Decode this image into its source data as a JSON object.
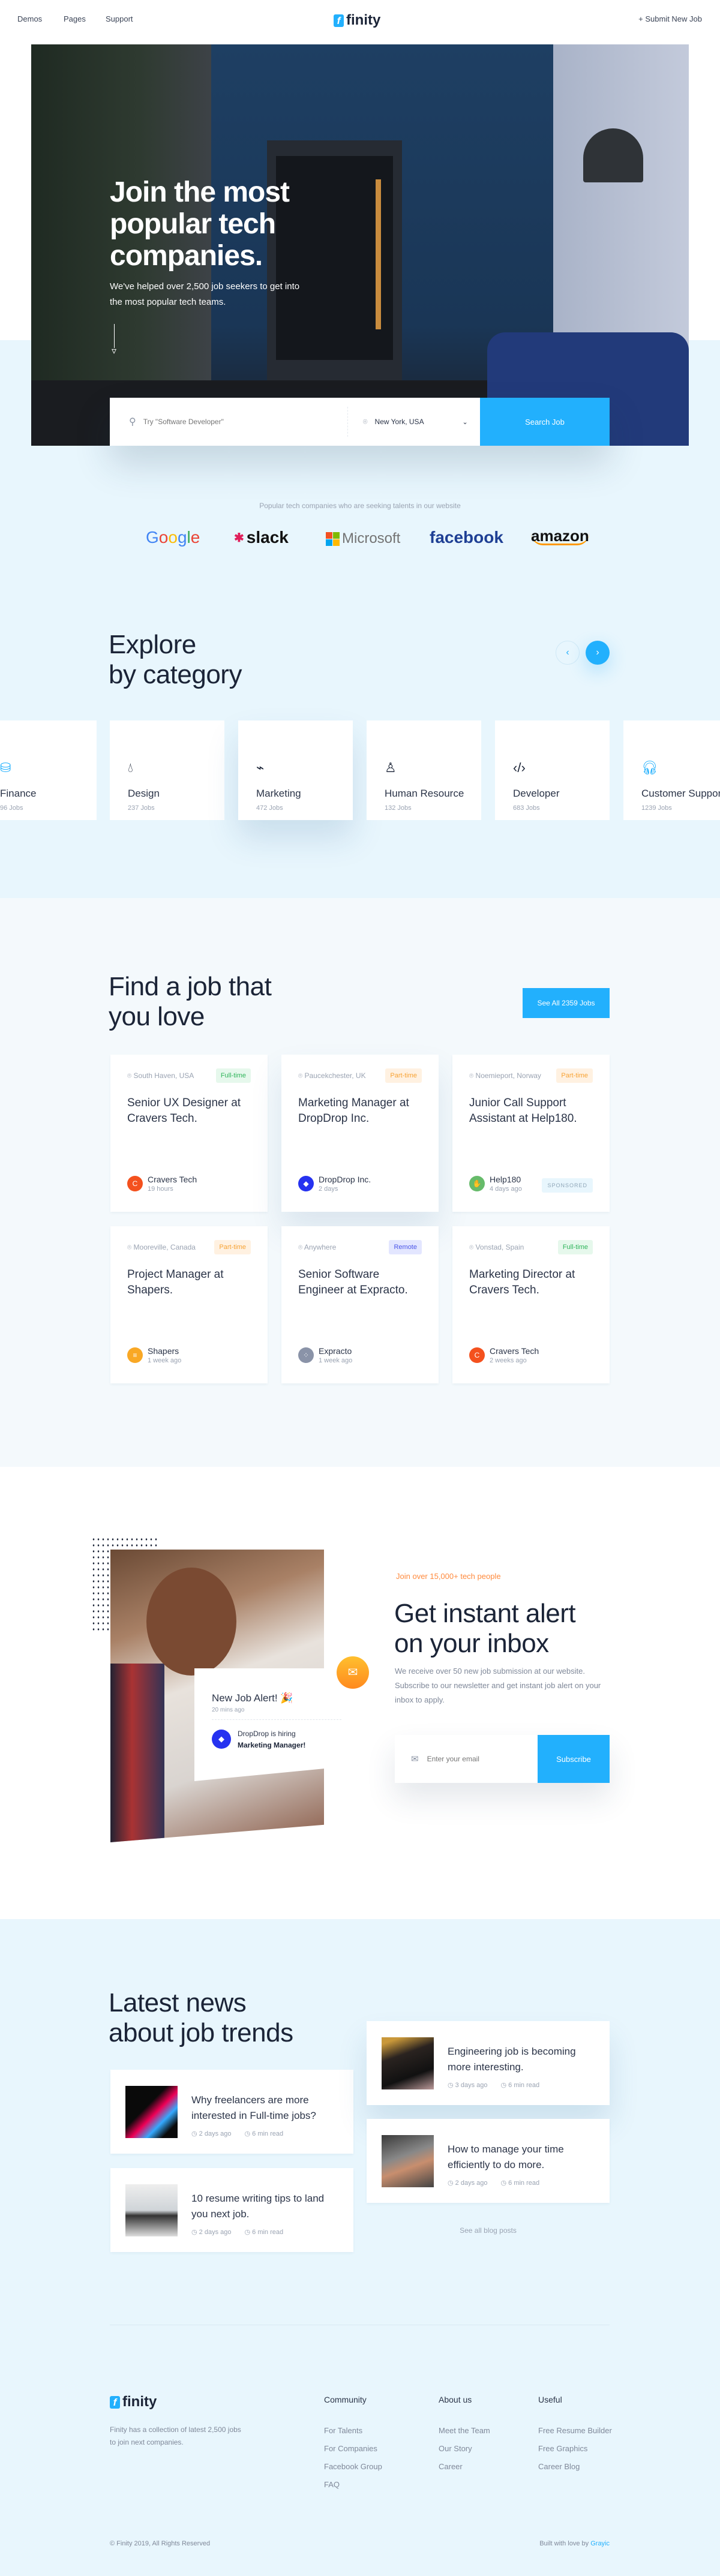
{
  "nav": {
    "links": [
      "Demos",
      "Pages",
      "Support"
    ],
    "logo": "finity",
    "logo_mark": "f",
    "submit": "Submit New Job"
  },
  "hero": {
    "title_lines": [
      "Join the most",
      "popular tech",
      "companies."
    ],
    "subtitle_lines": [
      "We've helped over 2,500 job seekers to get into",
      "the most popular tech teams."
    ],
    "search_placeholder": "Try \"Software Developer\"",
    "location": "New York, USA",
    "search_button": "Search Job"
  },
  "companies": {
    "caption": "Popular tech companies who are seeking talents in our website",
    "logos": [
      "Google",
      "slack",
      "Microsoft",
      "facebook",
      "amazon"
    ]
  },
  "categories": {
    "title_lines": [
      "Explore",
      "by category"
    ],
    "items": [
      {
        "name": "Finance",
        "count": "96 Jobs",
        "icon": "coins-icon"
      },
      {
        "name": "Design",
        "count": "237 Jobs",
        "icon": "drop-icon"
      },
      {
        "name": "Marketing",
        "count": "472 Jobs",
        "icon": "pulse-icon"
      },
      {
        "name": "Human Resource",
        "count": "132 Jobs",
        "icon": "person-icon"
      },
      {
        "name": "Developer",
        "count": "683 Jobs",
        "icon": "code-icon"
      },
      {
        "name": "Customer Support",
        "count": "1239 Jobs",
        "icon": "headphones-icon"
      }
    ]
  },
  "jobs": {
    "title_lines": [
      "Find a job that",
      "you love"
    ],
    "see_all": "See All 2359 Jobs",
    "sponsored_label": "SPONSORED",
    "items": [
      {
        "location": "South Haven, USA",
        "type": "Full-time",
        "title": "Senior UX Designer at Cravers Tech.",
        "company": "Cravers Tech",
        "time": "19 hours",
        "logo_color": "#f4511e",
        "logo_letter": "C"
      },
      {
        "location": "Paucekchester, UK",
        "type": "Part-time",
        "title": "Marketing Manager at DropDrop Inc.",
        "company": "DropDrop Inc.",
        "time": "2 days",
        "logo_color": "#2632f0",
        "logo_letter": "◆"
      },
      {
        "location": "Noemieport, Norway",
        "type": "Part-time",
        "title": "Junior Call Support Assistant at Help180.",
        "company": "Help180",
        "time": "4 days ago",
        "logo_color": "#66bb6a",
        "logo_letter": "✋",
        "sponsored": true
      },
      {
        "location": "Mooreville, Canada",
        "type": "Part-time",
        "title": "Project Manager at Shapers.",
        "company": "Shapers",
        "time": "1 week ago",
        "logo_color": "#f9a825",
        "logo_letter": "≡"
      },
      {
        "location": "Anywhere",
        "type": "Remote",
        "title": "Senior Software Engineer at Expracto.",
        "company": "Expracto",
        "time": "1 week ago",
        "logo_color": "#8a93a8",
        "logo_letter": "⁘"
      },
      {
        "location": "Vonstad, Spain",
        "type": "Full-time",
        "title": "Marketing Director at Cravers Tech.",
        "company": "Cravers Tech",
        "time": "2 weeks ago",
        "logo_color": "#f4511e",
        "logo_letter": "C"
      }
    ],
    "badge_colors": {
      "Full-time": [
        "#e6f8ec",
        "#2fb45a"
      ],
      "Part-time": [
        "#fff1e1",
        "#f7a233"
      ],
      "Remote": [
        "#e3e6ff",
        "#4a55e8"
      ]
    }
  },
  "alert": {
    "notification_title": "New Job Alert! 🎉",
    "notification_time": "20 mins ago",
    "hiring_line": "DropDrop is hiring",
    "hiring_role": "Marketing Manager!",
    "eyebrow": "Join over 15,000+ tech people",
    "title_lines": [
      "Get instant alert",
      "on your inbox"
    ],
    "description": "We receive over 50 new job submission at our website. Subscribe to our newsletter and get instant job alert on your inbox to apply.",
    "email_placeholder": "Enter your email",
    "subscribe": "Subscribe"
  },
  "news": {
    "title_lines": [
      "Latest news",
      "about job trends"
    ],
    "see_all": "See all blog posts",
    "items": [
      {
        "title": "Why freelancers are more interested in Full-time jobs?",
        "date": "2 days ago",
        "read": "6 min read"
      },
      {
        "title": "10 resume writing tips to land you next job.",
        "date": "2 days ago",
        "read": "6 min read"
      },
      {
        "title": "Engineering job is becoming more interesting.",
        "date": "3 days ago",
        "read": "6 min read"
      },
      {
        "title": "How to manage your time efficiently to do more.",
        "date": "2 days ago",
        "read": "6 min read"
      }
    ]
  },
  "footer": {
    "description": "Finity has a collection of latest 2,500 jobs to join next companies.",
    "columns": [
      {
        "title": "Community",
        "links": [
          "For Talents",
          "For Companies",
          "Facebook Group",
          "FAQ"
        ]
      },
      {
        "title": "About us",
        "links": [
          "Meet the Team",
          "Our Story",
          "Career"
        ]
      },
      {
        "title": "Useful",
        "links": [
          "Free Resume Builder",
          "Free Graphics",
          "Career Blog"
        ]
      }
    ],
    "copyright": "© Finity 2019, All Rights Reserved",
    "built_by": "Built with love by",
    "author": "Grayic"
  },
  "colors": {
    "accent": "#22b0fd",
    "orange": "#ff8a3d",
    "light_bg": "#e8f6fd",
    "dark_text": "#1b2437"
  }
}
